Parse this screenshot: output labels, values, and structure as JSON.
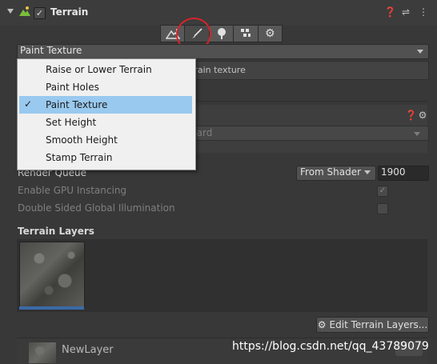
{
  "header": {
    "title": "Terrain",
    "icons": [
      "terrain-icon",
      "help-icon",
      "preset-icon",
      "kebab-menu-icon"
    ]
  },
  "toolbar": {
    "tools": [
      {
        "name": "raise-lower-tool",
        "glyph": "⛰"
      },
      {
        "name": "paint-brush-tool",
        "glyph": "🖌"
      },
      {
        "name": "trees-tool",
        "glyph": "🌲"
      },
      {
        "name": "details-tool",
        "glyph": "✿"
      },
      {
        "name": "settings-tool",
        "glyph": "⚙"
      }
    ],
    "active": "paint-brush-tool"
  },
  "tool_dropdown": {
    "selected": "Paint Texture",
    "options": [
      "Raise or Lower Terrain",
      "Paint Holes",
      "Paint Texture",
      "Set Height",
      "Smooth Height",
      "Stamp Terrain"
    ]
  },
  "help_box": {
    "text_partial": "rrain texture"
  },
  "material": {
    "value_partial": "dard"
  },
  "render_queue": {
    "label": "Render Queue",
    "mode": "From Shader",
    "value": "1900"
  },
  "gpu_instancing": {
    "label": "Enable GPU Instancing",
    "checked": true
  },
  "double_sided_gi": {
    "label": "Double Sided Global Illumination",
    "checked": false
  },
  "terrain_layers": {
    "title": "Terrain Layers",
    "edit_button": "Edit Terrain Layers...",
    "layer_name": "NewLayer"
  },
  "watermark": "https://blog.csdn.net/qq_43789079",
  "colors": {
    "accent": "#3a6aa6",
    "selection": "#99c9ef",
    "annotation": "#d8232a"
  }
}
